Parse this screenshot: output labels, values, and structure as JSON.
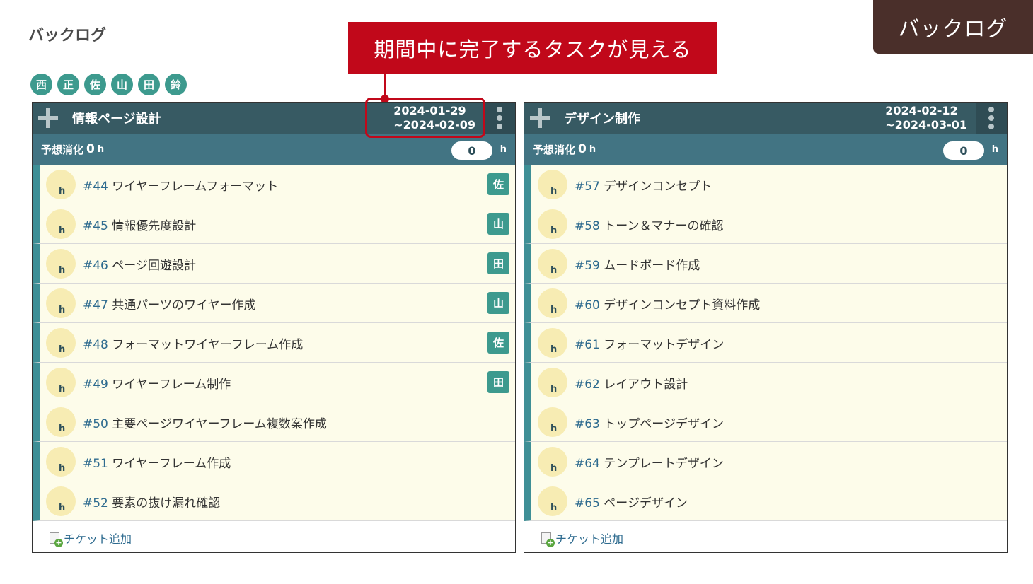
{
  "corner_badge": "バックログ",
  "page_title": "バックログ",
  "callout": "期間中に完了するタスクが見える",
  "members": [
    "西",
    "正",
    "佐",
    "山",
    "田",
    "鈴"
  ],
  "panels": [
    {
      "name": "情報ページ設計",
      "date_start": "2024-01-29",
      "date_end": "~2024-02-09",
      "estimate_label": "予想消化",
      "estimate_value": "0",
      "estimate_unit": "h",
      "estimate_input": "0",
      "estimate_input_unit": "h",
      "tickets": [
        {
          "id": "#44",
          "title": "ワイヤーフレームフォーマット",
          "assignee": "佐",
          "hours": "h"
        },
        {
          "id": "#45",
          "title": "情報優先度設計",
          "assignee": "山",
          "hours": "h"
        },
        {
          "id": "#46",
          "title": "ページ回遊設計",
          "assignee": "田",
          "hours": "h"
        },
        {
          "id": "#47",
          "title": "共通パーツのワイヤー作成",
          "assignee": "山",
          "hours": "h"
        },
        {
          "id": "#48",
          "title": "フォーマットワイヤーフレーム作成",
          "assignee": "佐",
          "hours": "h"
        },
        {
          "id": "#49",
          "title": "ワイヤーフレーム制作",
          "assignee": "田",
          "hours": "h"
        },
        {
          "id": "#50",
          "title": "主要ページワイヤーフレーム複数案作成",
          "assignee": "",
          "hours": "h"
        },
        {
          "id": "#51",
          "title": "ワイヤーフレーム作成",
          "assignee": "",
          "hours": "h"
        },
        {
          "id": "#52",
          "title": "要素の抜け漏れ確認",
          "assignee": "",
          "hours": "h"
        }
      ],
      "add_ticket": "チケット追加"
    },
    {
      "name": "デザイン制作",
      "date_start": "2024-02-12",
      "date_end": "~2024-03-01",
      "estimate_label": "予想消化",
      "estimate_value": "0",
      "estimate_unit": "h",
      "estimate_input": "0",
      "estimate_input_unit": "h",
      "tickets": [
        {
          "id": "#57",
          "title": "デザインコンセプト",
          "assignee": "",
          "hours": "h"
        },
        {
          "id": "#58",
          "title": "トーン＆マナーの確認",
          "assignee": "",
          "hours": "h"
        },
        {
          "id": "#59",
          "title": "ムードボード作成",
          "assignee": "",
          "hours": "h"
        },
        {
          "id": "#60",
          "title": "デザインコンセプト資料作成",
          "assignee": "",
          "hours": "h"
        },
        {
          "id": "#61",
          "title": "フォーマットデザイン",
          "assignee": "",
          "hours": "h"
        },
        {
          "id": "#62",
          "title": "レイアウト設計",
          "assignee": "",
          "hours": "h"
        },
        {
          "id": "#63",
          "title": "トップページデザイン",
          "assignee": "",
          "hours": "h"
        },
        {
          "id": "#64",
          "title": "テンプレートデザイン",
          "assignee": "",
          "hours": "h"
        },
        {
          "id": "#65",
          "title": "ページデザイン",
          "assignee": "",
          "hours": "h"
        }
      ],
      "add_ticket": "チケット追加"
    }
  ],
  "colors": {
    "accent_red": "#c1081a",
    "header_dark": "#375a63",
    "estimate_bar": "#427483",
    "member_teal": "#3d9a8e",
    "ticket_bg": "#fdfcea",
    "badge_brown": "#4a2f2a"
  },
  "icons": {
    "add_sprint": "plus-icon",
    "menu": "vertical-dots-icon",
    "add_ticket": "document-add-icon"
  }
}
